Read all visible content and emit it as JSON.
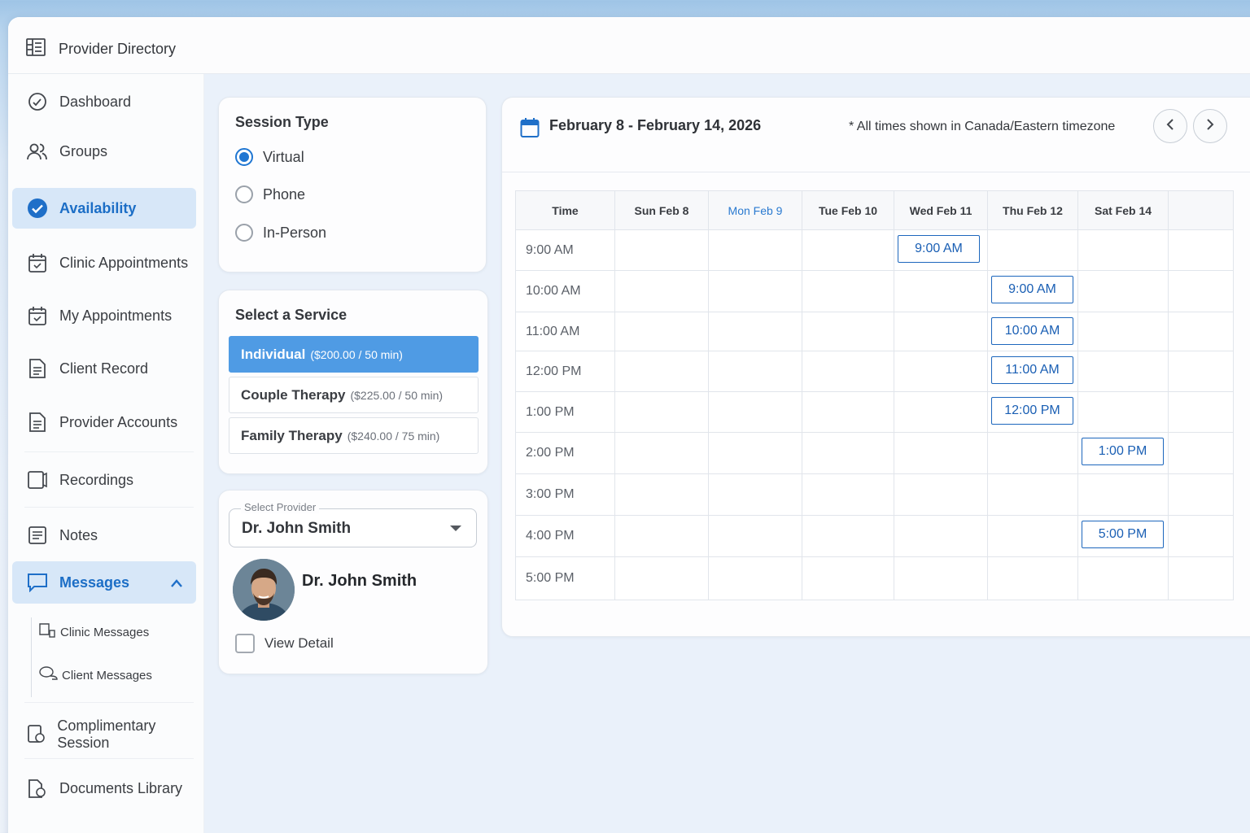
{
  "app": {
    "title": "Provider Directory",
    "accent_color": "#1f76d2",
    "brand_icon": "directory-icon"
  },
  "sidebar": {
    "items": [
      {
        "label": "Dashboard",
        "icon": "dashboard-icon"
      },
      {
        "label": "Groups",
        "icon": "groups-icon"
      },
      {
        "label": "Availability",
        "icon": "check-circle-icon",
        "active": true
      },
      {
        "label": "Clinic Appointments",
        "icon": "calendar-icon"
      },
      {
        "label": "My Appointments",
        "icon": "calendar-icon"
      },
      {
        "label": "Client Record",
        "icon": "document-icon"
      },
      {
        "label": "Provider Accounts",
        "icon": "document-icon"
      },
      {
        "label": "Recordings",
        "icon": "recording-icon"
      },
      {
        "label": "Notes",
        "icon": "notes-icon"
      },
      {
        "label": "Messages",
        "icon": "message-icon",
        "expanded": true
      },
      {
        "label": "Complimentary Session",
        "icon": "complimentary-icon"
      },
      {
        "label": "Documents Library",
        "icon": "library-icon"
      }
    ],
    "messages_sub": [
      {
        "label": "Clinic Messages",
        "icon": "clinic-messages-icon"
      },
      {
        "label": "Client Messages",
        "icon": "client-messages-icon"
      }
    ]
  },
  "session_type": {
    "title": "Session Type",
    "options": [
      "Virtual",
      "Phone",
      "In-Person"
    ],
    "selected": "Virtual"
  },
  "services": {
    "title": "Select a Service",
    "items": [
      {
        "name": "Individual",
        "price": "($200.00 / 50 min)",
        "selected": true
      },
      {
        "name": "Couple Therapy",
        "price": "($225.00 / 50 min)"
      },
      {
        "name": "Family Therapy",
        "price": "($240.00 / 75 min)"
      }
    ]
  },
  "provider": {
    "label": "Select Provider",
    "value": "Dr. John Smith",
    "name": "Dr. John Smith",
    "view_detail": "View Detail"
  },
  "calendar": {
    "range": "February 8 - February 14, 2026",
    "timezone_note": "* All times shown in Canada/Eastern timezone",
    "columns": [
      "Time",
      "Sun Feb 8",
      "Mon Feb 9",
      "Tue Feb 10",
      "Wed Feb 11",
      "Thu Feb 12",
      "Sat Feb 14",
      ""
    ],
    "today_col": 2,
    "rows": [
      "9:00 AM",
      "10:00 AM",
      "11:00 AM",
      "12:00 PM",
      "1:00 PM",
      "2:00 PM",
      "3:00 PM",
      "4:00 PM",
      "5:00 PM"
    ],
    "slots": [
      {
        "row": 0,
        "col": 4,
        "label": "9:00 AM"
      },
      {
        "row": 1,
        "col": 5,
        "label": "9:00 AM"
      },
      {
        "row": 2,
        "col": 5,
        "label": "10:00 AM"
      },
      {
        "row": 3,
        "col": 5,
        "label": "11:00 AM"
      },
      {
        "row": 4,
        "col": 5,
        "label": "12:00 PM"
      },
      {
        "row": 5,
        "col": 6,
        "label": "1:00 PM"
      },
      {
        "row": 7,
        "col": 6,
        "label": "5:00 PM"
      }
    ]
  }
}
